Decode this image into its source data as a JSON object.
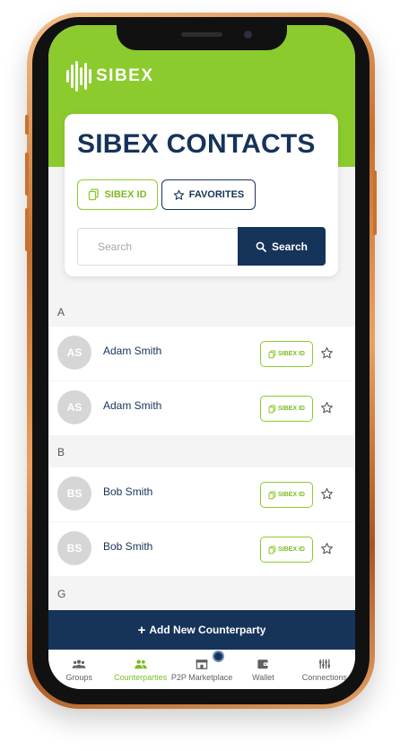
{
  "brand": {
    "logo_text": "SIBEX"
  },
  "card": {
    "title": "SIBEX CONTACTS",
    "sibex_id_label": "SIBEX ID",
    "favorites_label": "FAVORITES",
    "search_placeholder": "Search",
    "search_value": "",
    "search_button": "Search"
  },
  "sections": [
    {
      "letter": "A",
      "contacts": [
        {
          "initials": "AS",
          "name": "Adam Smith",
          "id_chip": "SIBEX ID"
        },
        {
          "initials": "AS",
          "name": "Adam Smith",
          "id_chip": "SIBEX ID"
        }
      ]
    },
    {
      "letter": "B",
      "contacts": [
        {
          "initials": "BS",
          "name": "Bob Smith",
          "id_chip": "SIBEX ID"
        },
        {
          "initials": "BS",
          "name": "Bob Smith",
          "id_chip": "SIBEX ID"
        }
      ]
    },
    {
      "letter": "G",
      "contacts": []
    }
  ],
  "add_button": {
    "label": "Add New Counterparty",
    "icon": "+"
  },
  "tabs": [
    {
      "label": "Groups",
      "icon": "groups-icon",
      "active": false
    },
    {
      "label": "Counterparties",
      "icon": "counterparties-icon",
      "active": true
    },
    {
      "label": "P2P Marketplace",
      "icon": "marketplace-icon",
      "active": false
    },
    {
      "label": "Wallet",
      "icon": "wallet-icon",
      "active": false
    },
    {
      "label": "Connections",
      "icon": "connections-icon",
      "active": false
    }
  ],
  "colors": {
    "brand_green": "#8ccb2e",
    "navy": "#16335a",
    "avatar_gray": "#d6d6d6"
  }
}
